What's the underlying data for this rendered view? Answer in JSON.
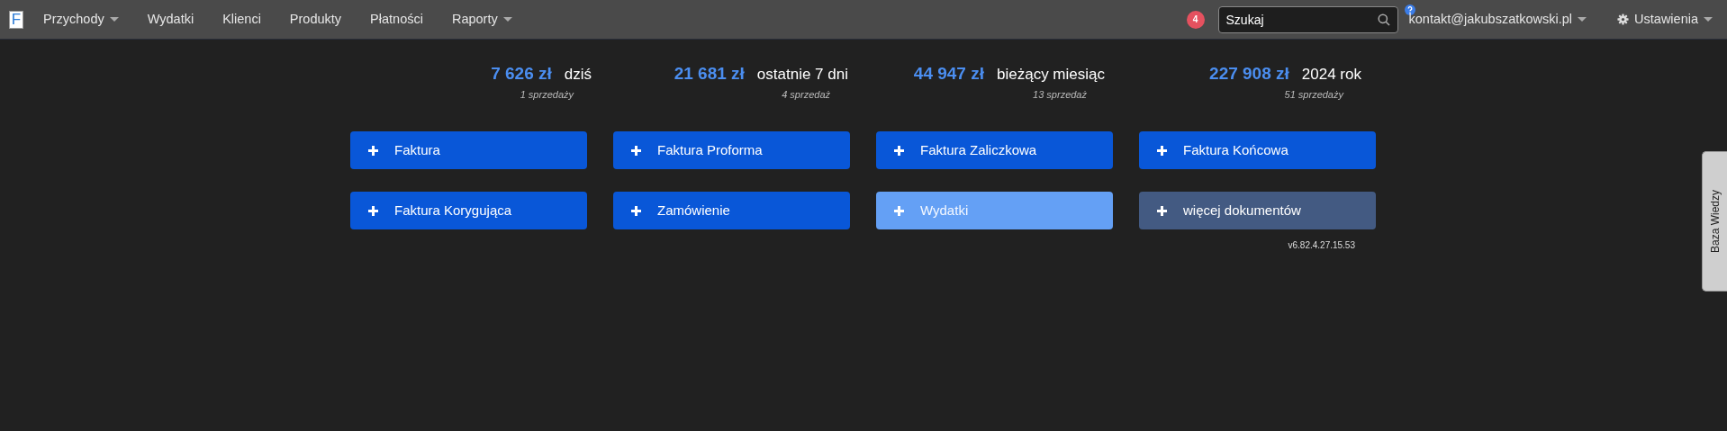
{
  "navbar": {
    "logo_letter": "F",
    "menu": [
      {
        "label": "Przychody",
        "dropdown": true
      },
      {
        "label": "Wydatki",
        "dropdown": false
      },
      {
        "label": "Klienci",
        "dropdown": false
      },
      {
        "label": "Produkty",
        "dropdown": false
      },
      {
        "label": "Płatności",
        "dropdown": false
      },
      {
        "label": "Raporty",
        "dropdown": true
      }
    ],
    "notifications": "4",
    "search": {
      "placeholder": "Szukaj"
    },
    "account": "kontakt@jakubszatkowski.pl",
    "settings": "Ustawienia"
  },
  "stats": [
    {
      "amount": "7 626 zł",
      "period": "dziś",
      "sales": "1 sprzedaży"
    },
    {
      "amount": "21 681 zł",
      "period": "ostatnie 7 dni",
      "sales": "4 sprzedaż"
    },
    {
      "amount": "44 947 zł",
      "period": "bieżący miesiąc",
      "sales": "13 sprzedaż"
    },
    {
      "amount": "227 908 zł",
      "period": "2024 rok",
      "sales": "51 sprzedaży"
    }
  ],
  "actions": [
    {
      "label": "Faktura",
      "kind": "document"
    },
    {
      "label": "Faktura Proforma",
      "kind": "document"
    },
    {
      "label": "Faktura Zaliczkowa",
      "kind": "document"
    },
    {
      "label": "Faktura Końcowa",
      "kind": "document"
    },
    {
      "label": "Faktura Korygująca",
      "kind": "document"
    },
    {
      "label": "Zamówienie",
      "kind": "document"
    },
    {
      "label": "Wydatki",
      "kind": "expense"
    },
    {
      "label": "więcej dokumentów",
      "kind": "more"
    }
  ],
  "version": "v6.82.4.27.15.53",
  "side_tab": "Baza Wiedzy"
}
